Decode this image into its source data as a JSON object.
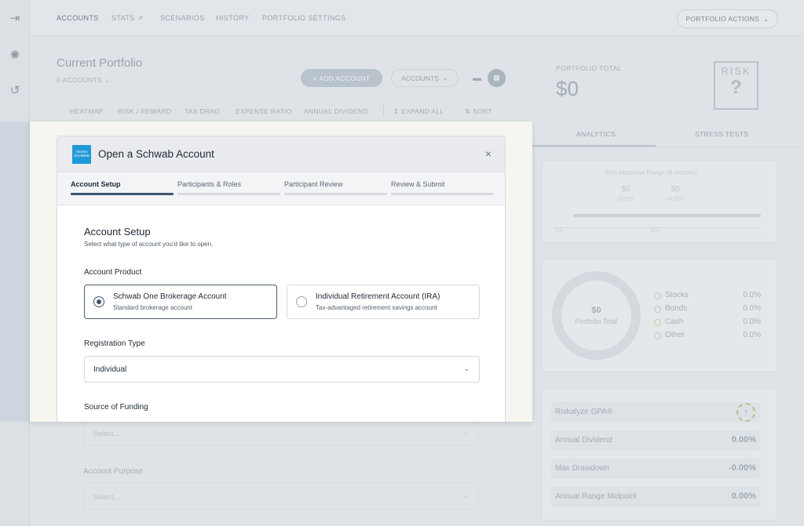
{
  "nav": {
    "tabs": [
      "ACCOUNTS",
      "STATS",
      "SCENARIOS",
      "HISTORY",
      "PORTFOLIO SETTINGS"
    ],
    "portfolio_actions": "PORTFOLIO ACTIONS"
  },
  "portfolio": {
    "title": "Current Portfolio",
    "account_count": "0 ACCOUNTS",
    "add_account": "ADD ACCOUNT",
    "accounts_dropdown": "ACCOUNTS",
    "heatmap_label": "HEATMAP:",
    "heatmap_items": [
      "RISK / REWARD",
      "TAX DRAG",
      "EXPENSE RATIO",
      "ANNUAL DIVIDEND"
    ],
    "expand_all": "EXPAND ALL",
    "sort": "SORT"
  },
  "right": {
    "total_label": "PORTFOLIO TOTAL",
    "total_value": "$0",
    "risk_label": "RISK",
    "risk_value": "?",
    "tabs": [
      "ANALYTICS",
      "STRESS TESTS"
    ],
    "range_title": "95% Historical Range (6 months)",
    "range_low_value": "$0",
    "range_low_pct": "0.00%",
    "range_high_value": "$0",
    "range_high_pct": "+0.00%",
    "range_scale_left": "0%",
    "range_scale_mid": "50%",
    "donut_value": "$0",
    "donut_label": "Portfolio Total",
    "allocations": [
      {
        "name": "Stocks",
        "pct": "0.0%"
      },
      {
        "name": "Bonds",
        "pct": "0.0%"
      },
      {
        "name": "Cash",
        "pct": "0.0%"
      },
      {
        "name": "Other",
        "pct": "0.0%"
      }
    ],
    "metrics": [
      {
        "label": "Riskalyze GPA®",
        "value": "?"
      },
      {
        "label": "Annual Dividend",
        "value": "0.00%"
      },
      {
        "label": "Max Drawdown",
        "value": "-0.00%"
      },
      {
        "label": "Annual Range Midpoint",
        "value": "0.00%"
      }
    ]
  },
  "modal": {
    "logo_line1": "charles",
    "logo_line2": "SCHWAB",
    "title": "Open a Schwab Account",
    "close": "×",
    "steps": [
      "Account Setup",
      "Participants & Roles",
      "Participant Review",
      "Review & Submit"
    ],
    "section_title": "Account Setup",
    "section_subtitle": "Select what type of account you'd like to open.",
    "product_label": "Account Product",
    "options": [
      {
        "title": "Schwab One Brokerage Account",
        "subtitle": "Standard brokerage account"
      },
      {
        "title": "Individual Retirement Account (IRA)",
        "subtitle": "Tax-advantaged retirement savings account"
      }
    ],
    "registration_label": "Registration Type",
    "registration_value": "Individual",
    "funding_label": "Source of Funding",
    "funding_placeholder": "Select...",
    "purpose_label": "Account Purpose",
    "purpose_placeholder": "Select..."
  }
}
